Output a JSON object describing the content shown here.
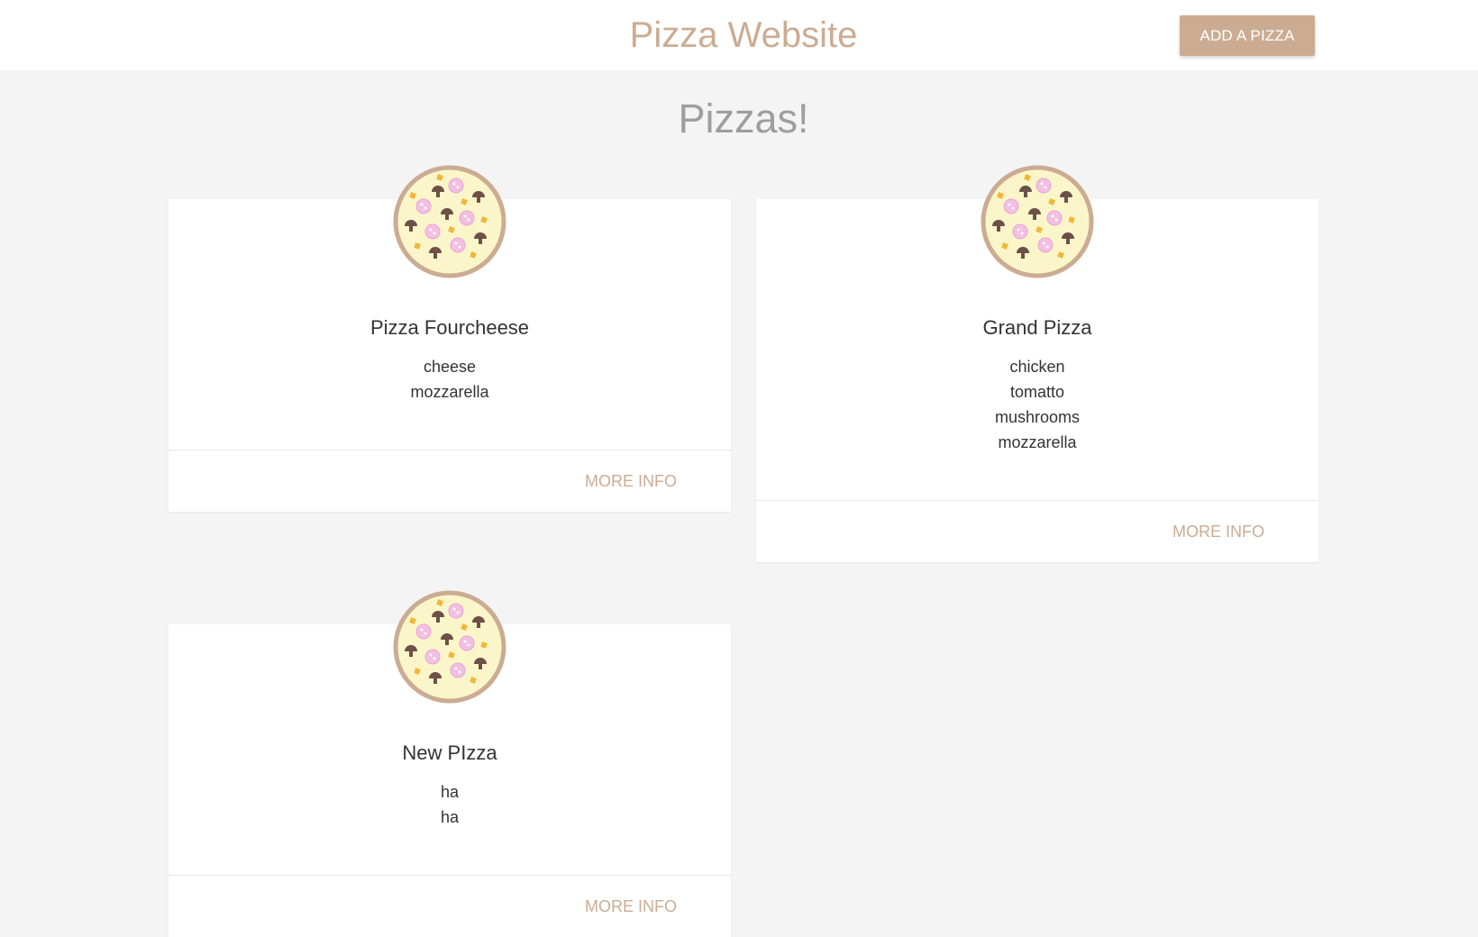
{
  "header": {
    "brand": "Pizza Website",
    "add_button": "ADD A PIZZA"
  },
  "main": {
    "title": "Pizzas!"
  },
  "pizzas": [
    {
      "title": "Pizza Fourcheese",
      "ingredients": [
        "cheese",
        "mozzarella"
      ],
      "action": "MORE INFO",
      "icon": "pizza-icon"
    },
    {
      "title": "Grand Pizza",
      "ingredients": [
        "chicken",
        "tomatto",
        "mushrooms",
        "mozzarella"
      ],
      "action": "MORE INFO",
      "icon": "pizza-icon"
    },
    {
      "title": "New PIzza",
      "ingredients": [
        "ha",
        "ha"
      ],
      "action": "MORE INFO",
      "icon": "pizza-icon"
    }
  ],
  "colors": {
    "brand": "#cbac93",
    "background": "#f4f4f4",
    "card": "#ffffff",
    "title_gray": "#9e9e9e"
  }
}
